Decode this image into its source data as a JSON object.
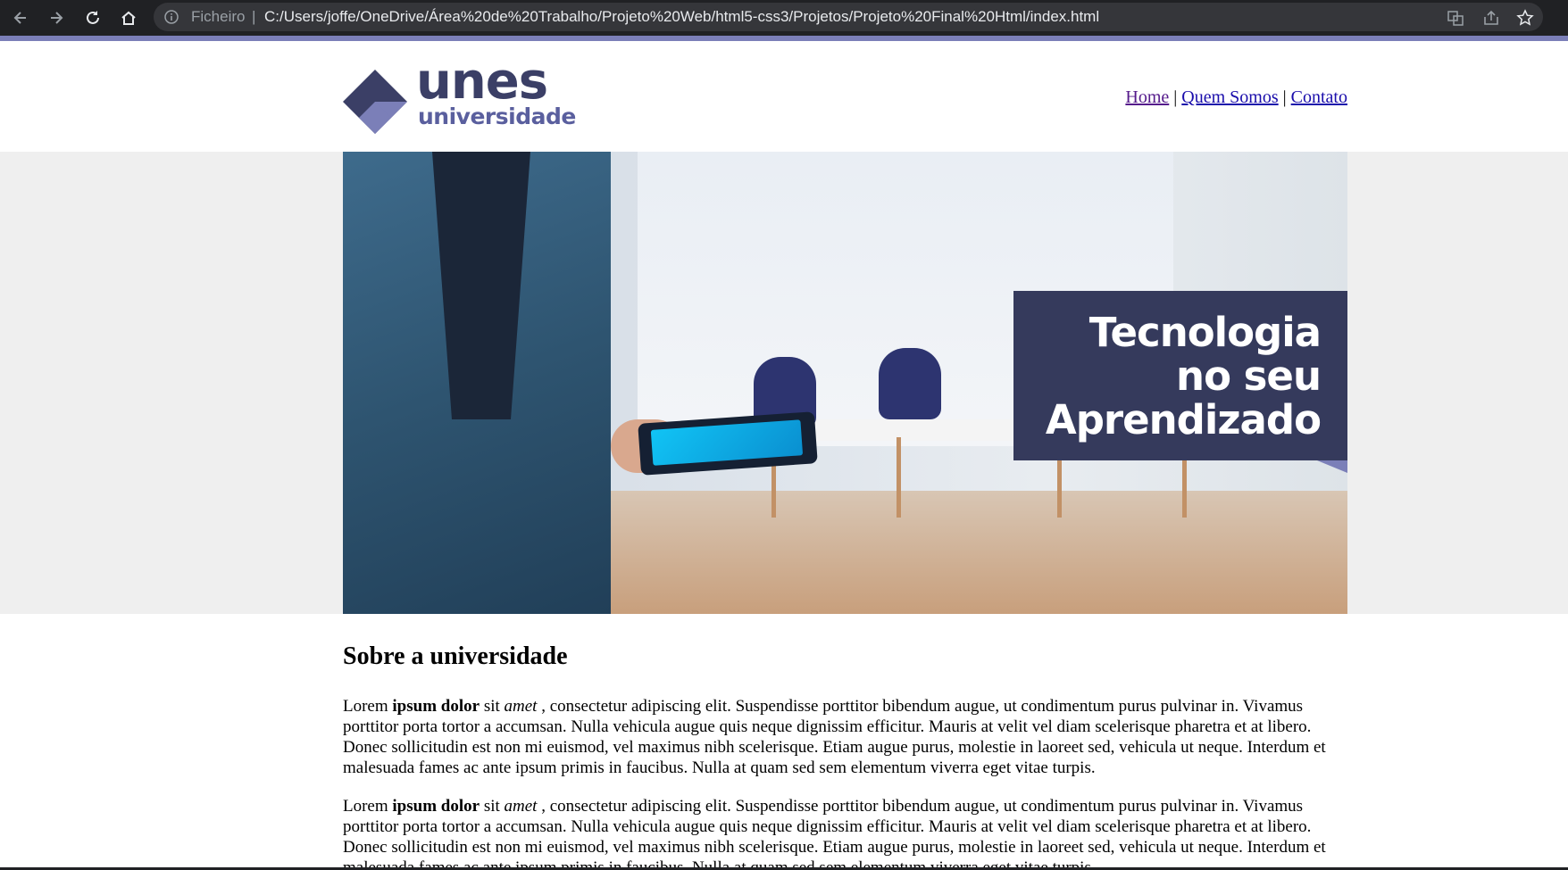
{
  "browser": {
    "scheme_label": "Ficheiro",
    "separator": "|",
    "url": "C:/Users/joffe/OneDrive/Área%20de%20Trabalho/Projeto%20Web/html5-css3/Projetos/Projeto%20Final%20Html/index.html",
    "icons": [
      "back-arrow-icon",
      "forward-arrow-icon",
      "reload-icon",
      "home-icon",
      "info-icon",
      "translate-icon",
      "share-icon",
      "star-icon"
    ]
  },
  "header": {
    "logo_word": "unes",
    "logo_sub": "universidade",
    "nav": [
      {
        "label": "Home"
      },
      {
        "label": "Quem Somos"
      },
      {
        "label": "Contato"
      }
    ],
    "nav_separator": "|"
  },
  "hero": {
    "lines": [
      "Tecnologia",
      "no seu",
      "Aprendizado"
    ]
  },
  "content": {
    "title": "Sobre a universidade",
    "paragraph": {
      "w1": "Lorem",
      "w2": "ipsum dolor",
      "w3": "sit",
      "w4": "amet",
      "rest": ", consectetur adipiscing elit. Suspendisse porttitor bibendum augue, ut condimentum purus pulvinar in. Vivamus porttitor porta tortor a accumsan. Nulla vehicula augue quis neque dignissim efficitur. Mauris at velit vel diam scelerisque pharetra et at libero. Donec sollicitudin est non mi euismod, vel maximus nibh scelerisque. Etiam augue purus, molestie in laoreet sed, vehicula ut neque. Interdum et malesuada fames ac ante ipsum primis in faucibus. Nulla at quam sed sem elementum viverra eget vitae turpis."
    }
  },
  "colors": {
    "chrome_bg": "#202124",
    "accent": "#7b7fb8",
    "brand_dark": "#3b3f66",
    "brand_light": "#5a5f9e",
    "hero_box": "#353a5c",
    "link": "#1a0dab",
    "link_visited": "#551a8b"
  }
}
